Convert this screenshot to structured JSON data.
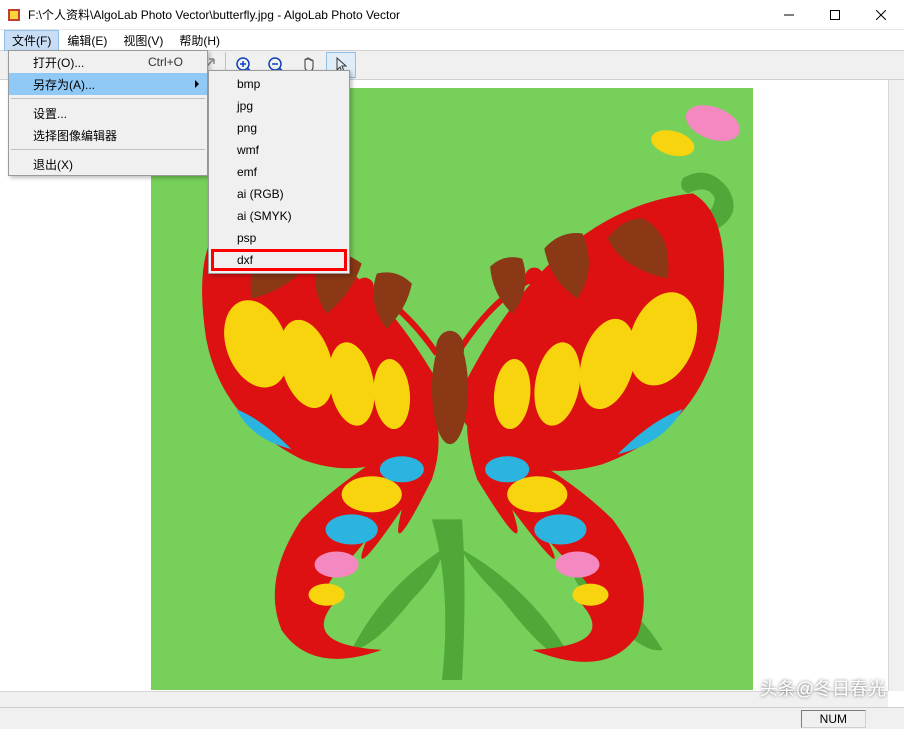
{
  "window": {
    "title": "F:\\个人资料\\AlgoLab Photo Vector\\butterfly.jpg - AlgoLab Photo Vector"
  },
  "menubar": {
    "file": "文件(F)",
    "edit": "编辑(E)",
    "view": "视图(V)",
    "help": "帮助(H)"
  },
  "file_menu": {
    "open": "打开(O)...",
    "open_shortcut": "Ctrl+O",
    "save_as": "另存为(A)...",
    "settings": "设置...",
    "select_editor": "选择图像编辑器",
    "exit": "退出(X)"
  },
  "save_as_menu": {
    "bmp": "bmp",
    "jpg": "jpg",
    "png": "png",
    "wmf": "wmf",
    "emf": "emf",
    "ai_rgb": "ai (RGB)",
    "ai_smyk": "ai (SMYK)",
    "psp": "psp",
    "dxf": "dxf"
  },
  "status": {
    "num": "NUM"
  },
  "watermark": "头条@冬日春光"
}
